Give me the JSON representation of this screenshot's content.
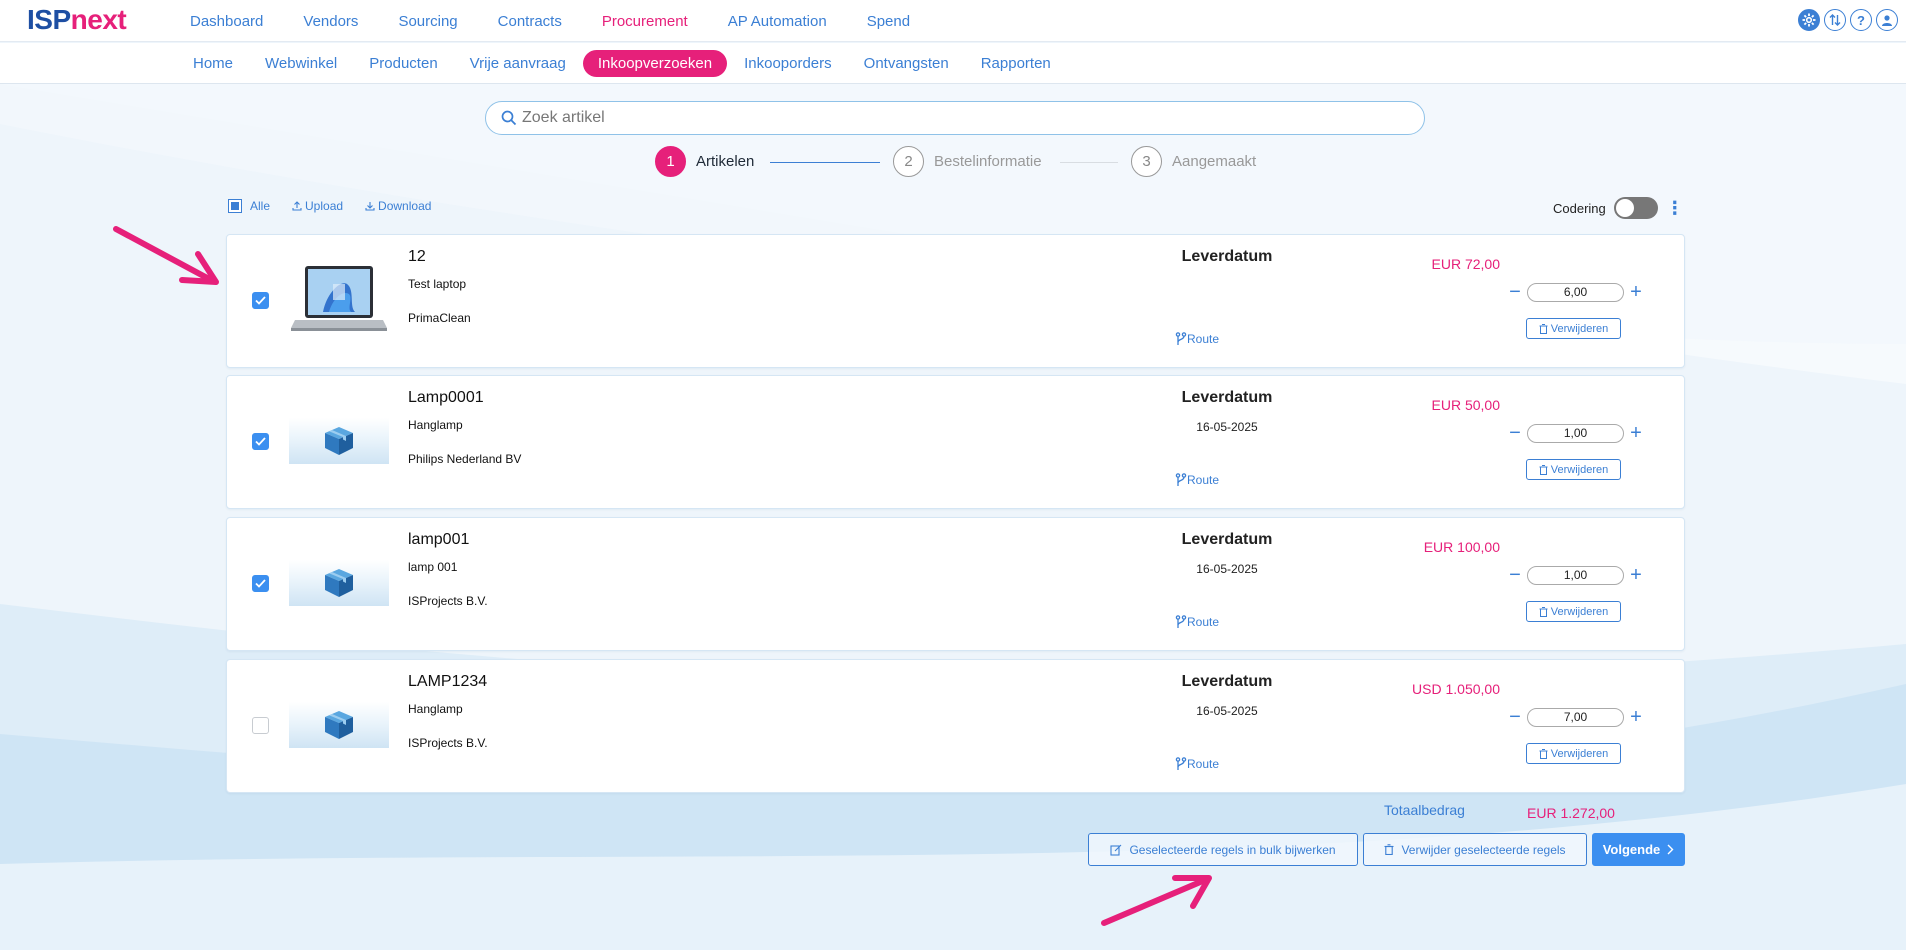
{
  "brand": {
    "part1": "ISP",
    "part2": "next"
  },
  "main_nav": [
    {
      "label": "Dashboard",
      "active": false
    },
    {
      "label": "Vendors",
      "active": false
    },
    {
      "label": "Sourcing",
      "active": false
    },
    {
      "label": "Contracts",
      "active": false
    },
    {
      "label": "Procurement",
      "active": true
    },
    {
      "label": "AP Automation",
      "active": false
    },
    {
      "label": "Spend",
      "active": false
    }
  ],
  "top_icons": {
    "help": "?"
  },
  "sub_nav": [
    {
      "label": "Home",
      "active": false
    },
    {
      "label": "Webwinkel",
      "active": false
    },
    {
      "label": "Producten",
      "active": false
    },
    {
      "label": "Vrije aanvraag",
      "active": false
    },
    {
      "label": "Inkoopverzoeken",
      "active": true
    },
    {
      "label": "Inkooporders",
      "active": false
    },
    {
      "label": "Ontvangsten",
      "active": false
    },
    {
      "label": "Rapporten",
      "active": false
    }
  ],
  "search": {
    "placeholder": "Zoek artikel",
    "value": ""
  },
  "steps": [
    {
      "number": "1",
      "label": "Artikelen",
      "active": true
    },
    {
      "number": "2",
      "label": "Bestelinformatie",
      "active": false
    },
    {
      "number": "3",
      "label": "Aangemaakt",
      "active": false
    }
  ],
  "toolbar": {
    "all_label": "Alle",
    "upload_label": "Upload",
    "download_label": "Download",
    "codering_label": "Codering",
    "kebab": "⋮"
  },
  "items": [
    {
      "code": "12",
      "description": "Test laptop",
      "supplier": "PrimaClean",
      "delivery_label": "Leverdatum",
      "delivery_date": "",
      "route_label": "Route",
      "price": "EUR 72,00",
      "quantity": "6,00",
      "delete_label": "Verwijderen",
      "checked": true,
      "thumbnail": "laptop"
    },
    {
      "code": "Lamp0001",
      "description": "Hanglamp",
      "supplier": "Philips Nederland BV",
      "delivery_label": "Leverdatum",
      "delivery_date": "16-05-2025",
      "route_label": "Route",
      "price": "EUR 50,00",
      "quantity": "1,00",
      "delete_label": "Verwijderen",
      "checked": true,
      "thumbnail": "box"
    },
    {
      "code": "lamp001",
      "description": "lamp 001",
      "supplier": "ISProjects B.V.",
      "delivery_label": "Leverdatum",
      "delivery_date": "16-05-2025",
      "route_label": "Route",
      "price": "EUR 100,00",
      "quantity": "1,00",
      "delete_label": "Verwijderen",
      "checked": true,
      "thumbnail": "box"
    },
    {
      "code": "LAMP1234",
      "description": "Hanglamp",
      "supplier": "ISProjects B.V.",
      "delivery_label": "Leverdatum",
      "delivery_date": "16-05-2025",
      "route_label": "Route",
      "price": "USD 1.050,00",
      "quantity": "7,00",
      "delete_label": "Verwijderen",
      "checked": false,
      "thumbnail": "box"
    }
  ],
  "qty_minus": "−",
  "qty_plus": "+",
  "total": {
    "label": "Totaalbedrag",
    "value": "EUR 1.272,00"
  },
  "actions": {
    "bulk_edit": "Geselecteerde regels in bulk bijwerken",
    "delete_selected": "Verwijder geselecteerde regels",
    "next": "Volgende"
  },
  "colors": {
    "primary": "#3b7fd4",
    "accent": "#e6207a",
    "check": "#3b8ff0",
    "annotation_arrow": "#e6207a"
  }
}
